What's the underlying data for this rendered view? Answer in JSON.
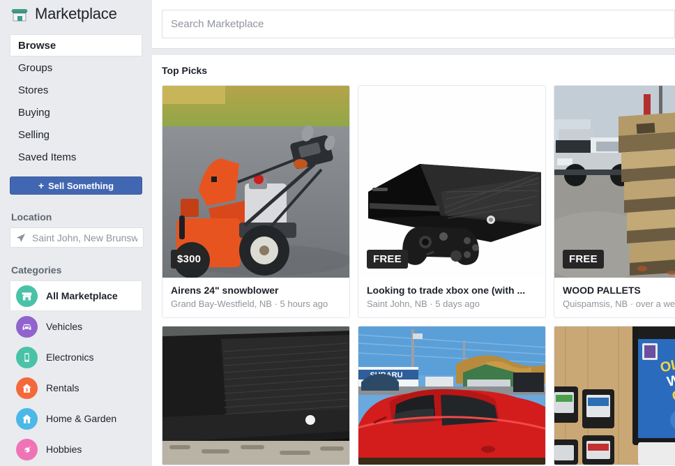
{
  "brand": {
    "title": "Marketplace",
    "logo_icon": "storefront-icon",
    "logo_color": "#3a9e8c"
  },
  "sidebar": {
    "nav": [
      {
        "label": "Browse",
        "active": true
      },
      {
        "label": "Groups",
        "active": false
      },
      {
        "label": "Stores",
        "active": false
      },
      {
        "label": "Buying",
        "active": false
      },
      {
        "label": "Selling",
        "active": false
      },
      {
        "label": "Saved Items",
        "active": false
      }
    ],
    "sell_button": {
      "label": "Sell Something",
      "plus": "+",
      "color": "#4267b2"
    },
    "location": {
      "heading": "Location",
      "icon": "location-arrow-icon",
      "value": "Saint John, New Brunswick"
    },
    "categories": {
      "heading": "Categories",
      "items": [
        {
          "label": "All Marketplace",
          "icon": "storefront-icon",
          "color": "#4ac2a8",
          "active": true
        },
        {
          "label": "Vehicles",
          "icon": "car-icon",
          "color": "#9063cd",
          "active": false
        },
        {
          "label": "Electronics",
          "icon": "phone-icon",
          "color": "#4ac2a8",
          "active": false
        },
        {
          "label": "Rentals",
          "icon": "house-dollar-icon",
          "color": "#f4693c",
          "active": false
        },
        {
          "label": "Home & Garden",
          "icon": "house-icon",
          "color": "#4cb8e8",
          "active": false
        },
        {
          "label": "Hobbies",
          "icon": "guitar-icon",
          "color": "#ef74b6",
          "active": false
        }
      ]
    }
  },
  "search": {
    "placeholder": "Search Marketplace",
    "value": ""
  },
  "feed": {
    "title": "Top Picks",
    "listings": [
      {
        "price": "$300",
        "title": "Airens 24\" snowblower",
        "meta": "Grand Bay-Westfield, NB · 5 hours ago",
        "photo": "orange-snowblower-on-driveway"
      },
      {
        "price": "FREE",
        "title": "Looking to trade xbox one (with ...",
        "meta": "Saint John, NB · 5 days ago",
        "photo": "black-xbox-one-console-and-controller"
      },
      {
        "price": "FREE",
        "title": "WOOD PALLETS",
        "meta": "Quispamsis, NB · over a week ago",
        "photo": "stacked-wood-pallets-with-truck"
      }
    ],
    "listings_row2": [
      {
        "photo": "dark-black-electronics-closeup"
      },
      {
        "photo": "red-car-at-subaru-dealership"
      },
      {
        "photo": "nintendo-ds-game-cartridges-on-wood"
      }
    ]
  }
}
